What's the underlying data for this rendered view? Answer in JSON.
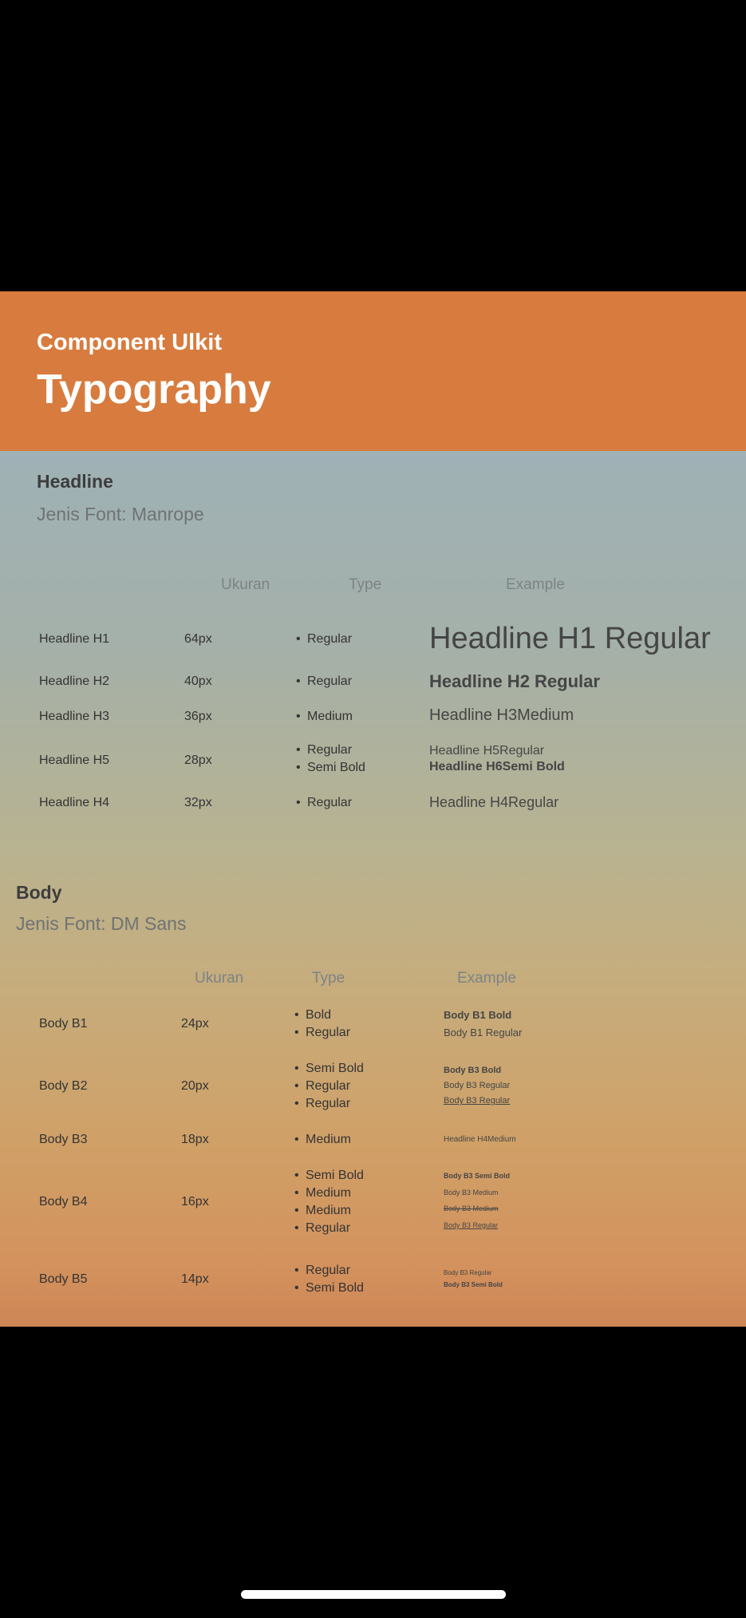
{
  "header": {
    "subtitle": "Component Ulkit",
    "title": "Typography"
  },
  "headline": {
    "title": "Headline",
    "font": "Jenis Font: Manrope",
    "columns": {
      "size": "Ukuran",
      "type": "Type",
      "example": "Example"
    },
    "rows": [
      {
        "name": "Headline H1",
        "size": "64px",
        "types": [
          "Regular"
        ],
        "examples": [
          "Headline H1 Regular"
        ]
      },
      {
        "name": "Headline H2",
        "size": "40px",
        "types": [
          "Regular"
        ],
        "examples": [
          "Headline H2 Regular"
        ]
      },
      {
        "name": "Headline H3",
        "size": "36px",
        "types": [
          "Medium"
        ],
        "examples": [
          "Headline H3Medium"
        ]
      },
      {
        "name": "Headline H5",
        "size": "28px",
        "types": [
          "Regular",
          "Semi Bold"
        ],
        "examples": [
          "Headline H5Regular",
          "Headline H6Semi Bold"
        ]
      },
      {
        "name": "Headline H4",
        "size": "32px",
        "types": [
          "Regular"
        ],
        "examples": [
          "Headline H4Regular"
        ]
      }
    ]
  },
  "body": {
    "title": "Body",
    "font": "Jenis Font: DM Sans",
    "columns": {
      "size": "Ukuran",
      "type": "Type",
      "example": "Example"
    },
    "rows": [
      {
        "name": "Body B1",
        "size": "24px",
        "types": [
          "Bold",
          "Regular"
        ],
        "examples": [
          "Body B1 Bold",
          "Body B1 Regular"
        ]
      },
      {
        "name": "Body B2",
        "size": "20px",
        "types": [
          "Semi Bold",
          "Regular",
          "Regular"
        ],
        "examples": [
          "Body B3 Bold",
          "Body B3 Regular",
          "Body B3 Regular"
        ]
      },
      {
        "name": "Body B3",
        "size": "18px",
        "types": [
          "Medium"
        ],
        "examples": [
          "Headline H4Medium"
        ]
      },
      {
        "name": "Body B4",
        "size": "16px",
        "types": [
          "Semi Bold",
          "Medium",
          "Medium",
          "Regular"
        ],
        "examples": [
          "Body B3 Semi Bold",
          "Body B3 Medium",
          "Body B3 Medium",
          "Body B3 Regular"
        ]
      },
      {
        "name": "Body B5",
        "size": "14px",
        "types": [
          "Regular",
          "Semi Bold"
        ],
        "examples": [
          "Body B3 Regular",
          "Body B3 Semi Bold"
        ]
      }
    ]
  }
}
